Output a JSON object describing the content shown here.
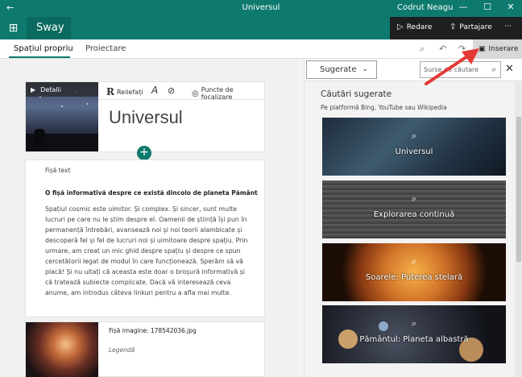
{
  "titlebar": {
    "back": "←",
    "title": "Universul",
    "user": "Codrut Neagu",
    "minimize": "—",
    "maximize": "☐",
    "close": "✕"
  },
  "appbar": {
    "grid": "⊞",
    "app_name": "Sway",
    "play_icon": "▷",
    "play_label": "Redare",
    "share_icon": "⇪",
    "share_label": "Partajare",
    "more": "···"
  },
  "tabs": {
    "items": [
      {
        "label": "Spațiul propriu"
      },
      {
        "label": "Proiectare"
      }
    ],
    "search_icon": "⌕",
    "undo_icon": "↶",
    "redo_icon": "↷",
    "insert_icon": "▣",
    "insert_label": "Inserare"
  },
  "storyline": {
    "title_card": {
      "details_arrow": "▶",
      "details_label": "Detalii",
      "tool_bold": "R",
      "tool_bold_label": "Reliefați",
      "tool_font": "A",
      "tool_link": "⊘",
      "tool_focus_icon": "◎",
      "tool_focus_label": "Puncte de focalizare",
      "title": "Universul",
      "add": "+"
    },
    "text_card": {
      "label": "Fișă text",
      "heading": "O fișă informativă despre ce există dincolo de planeta Pământ",
      "body": "Spațiul cosmic este uimitor. Și complex. Și sincer, sunt multe lucruri pe care nu le știm despre el. Oamenii de știință își pun în permanență întrebări, avansează noi și noi teorii alambicate și descoperă fel și fel de lucruri noi și uimitoare despre spațiu. Prin urmare, am creat un mic ghid despre spațiu și despre ce spun cercetătorii legat de modul în care funcționează. Sperăm să vă placă! Și nu uitați că aceasta este doar o broșură informativă și că tratează subiecte complicate. Dacă vă interesează ceva anume, am introdus câteva linkuri pentru a afla mai multe."
    },
    "image_card": {
      "label": "Fișă imagine: 178542036.jpg",
      "caption": "Legendă"
    }
  },
  "pane": {
    "dropdown": "Sugerate",
    "dropdown_chevron": "⌄",
    "search_placeholder": "Surse de căutare",
    "search_icon": "⌕",
    "close": "✕",
    "title": "Căutări sugerate",
    "subtitle": "Pe platformă Bing, YouTube sau Wikipedia",
    "tiles": [
      {
        "label": "Universul"
      },
      {
        "label": "Explorarea continuă"
      },
      {
        "label": "Soarele: Puterea stelară"
      },
      {
        "label": "Pământul: Planeta albastră"
      }
    ],
    "tile_icon": "⌕"
  },
  "colors": {
    "accent": "#0e7a6e",
    "command_bar": "#1f1f1f",
    "arrow": "#e53935"
  }
}
